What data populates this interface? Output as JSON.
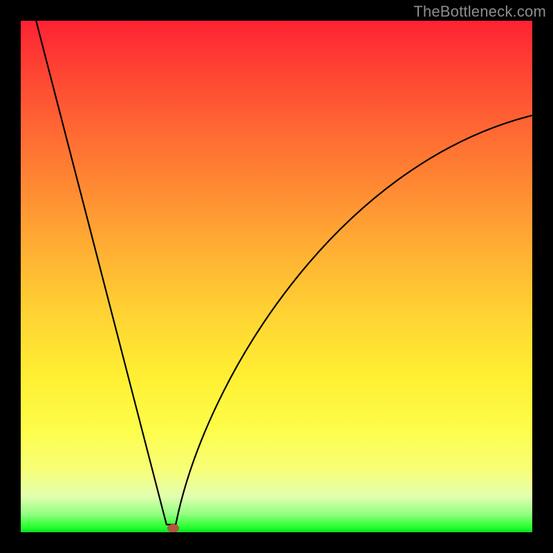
{
  "attribution": "TheBottleneck.com",
  "chart_data": {
    "type": "line",
    "title": "",
    "xlabel": "",
    "ylabel": "",
    "xlim": [
      0,
      1
    ],
    "ylim": [
      0,
      1
    ],
    "curve": {
      "left_start": {
        "x": 0.03,
        "y": 1.0
      },
      "dip": {
        "x": 0.285,
        "y": 0.015
      },
      "right_end": {
        "x": 1.0,
        "y": 0.815
      },
      "left_control": {
        "x": 0.21,
        "y": 0.3
      },
      "right_c1": {
        "x": 0.36,
        "y": 0.3
      },
      "right_c2": {
        "x": 0.62,
        "y": 0.72
      }
    },
    "marker": {
      "x": 0.298,
      "y": 0.008,
      "rx": 0.011,
      "ry": 0.008
    },
    "gradient_stops": [
      {
        "pos": 0.0,
        "color": "#fe2233"
      },
      {
        "pos": 0.1,
        "color": "#fe4433"
      },
      {
        "pos": 0.22,
        "color": "#ff6a33"
      },
      {
        "pos": 0.33,
        "color": "#ff8b33"
      },
      {
        "pos": 0.45,
        "color": "#ffb033"
      },
      {
        "pos": 0.57,
        "color": "#ffd233"
      },
      {
        "pos": 0.7,
        "color": "#fff033"
      },
      {
        "pos": 0.8,
        "color": "#fdfd4a"
      },
      {
        "pos": 0.88,
        "color": "#f7ff7a"
      },
      {
        "pos": 0.93,
        "color": "#e2ffb0"
      },
      {
        "pos": 0.965,
        "color": "#90ff80"
      },
      {
        "pos": 0.992,
        "color": "#1fff28"
      },
      {
        "pos": 1.0,
        "color": "#0cd62a"
      }
    ]
  }
}
